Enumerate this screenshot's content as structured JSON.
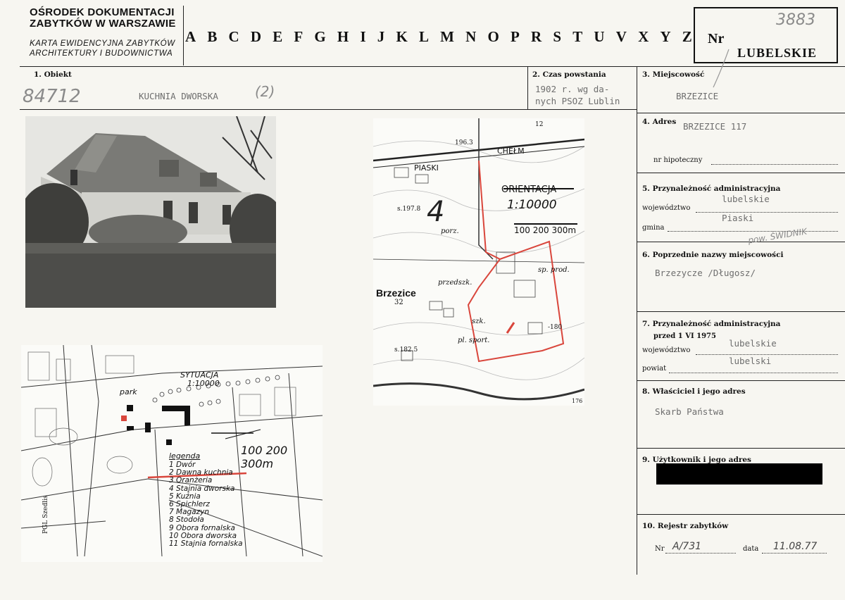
{
  "header": {
    "org_line1": "OŚRODEK DOKUMENTACJI",
    "org_line2": "ZABYTKÓW W WARSZAWIE",
    "subtitle_line1": "KARTA EWIDENCYJNA ZABYTKÓW",
    "subtitle_line2": "ARCHITEKTURY I BUDOWNICTWA",
    "letters": [
      "A",
      "B",
      "C",
      "D",
      "E",
      "F",
      "G",
      "H",
      "I",
      "J",
      "K",
      "L",
      "M",
      "N",
      "O",
      "P",
      "R",
      "S",
      "T",
      "U",
      "V",
      "X",
      "Y",
      "Z"
    ],
    "nr_label": "Nr",
    "nr_value": "3883",
    "region": "LUBELSKIE"
  },
  "fields": {
    "obiekt_label": "1. Obiekt",
    "obiekt_hand": "84712",
    "obiekt_value": "KUCHNIA DWORSKA",
    "obiekt_note": "(2)",
    "czas_label": "2. Czas powstania",
    "czas_line1": "1902 r. wg da-",
    "czas_line2": "nych PSOZ Lublin",
    "miejsc_label": "3. Miejscowość",
    "miejsc_value": "BRZEZICE",
    "adres_label": "4. Adres",
    "adres_value": "BRZEZICE 117",
    "hipoteczny_label": "nr hipoteczny",
    "przyn_label": "5. Przynależność administracyjna",
    "woj_label": "województwo",
    "woj_value": "lubelskie",
    "gmina_label": "gmina",
    "gmina_value": "Piaski",
    "pow_hand": "pow. ŚWIDNIK",
    "poprz_label": "6. Poprzednie nazwy miejscowości",
    "poprz_value": "Brzezycze /Długosz/",
    "przyn75_label": "7. Przynależność administracyjna",
    "przed_label": "przed 1 VI 1975",
    "woj75_label": "województwo",
    "woj75_value": "lubelskie",
    "powiat_label": "powiat",
    "powiat_value": "lubelski",
    "wlasc_label": "8. Właściciel i jego adres",
    "wlasc_value": "Skarb Państwa",
    "uzytk_label": "9. Użytkownik i jego adres",
    "rejestr_label": "10. Rejestr zabytków",
    "rej_nr_label": "Nr",
    "rej_nr_value": "A/731",
    "rej_data_label": "data",
    "rej_data_value": "11.08.77"
  },
  "topo_map": {
    "orientacja": "ORIENTACJA",
    "scale": "1:10000",
    "scale_ticks": "100 200 300m",
    "labels": [
      "PIASKI",
      "CHEŁM",
      "Brzezice",
      "32",
      "porz.",
      "przedszk.",
      "sp. prod.",
      "szk.",
      "pl. sport.",
      "s.197.8",
      "s.182.5",
      "196.3",
      "12",
      "4",
      "-180",
      "176"
    ]
  },
  "site_plan": {
    "sytuacja": "SYTUACJA",
    "scale": "1:10000",
    "scale_ticks": "100  200 300m",
    "park": "park",
    "pgl": "PGL Szedlis",
    "legend_title": "legenda",
    "legend": [
      "1 Dwór",
      "2 Dawna kuchnia",
      "3 Oranżeria",
      "4 Stajnia dworska",
      "5 Kuźnia",
      "6 Spichlerz",
      "7 Magazyn",
      "8 Stodoła",
      "9 Obora fornalska",
      "10 Obora dworska",
      "11 Stajnia fornalska"
    ]
  },
  "colors": {
    "red_marking": "#d9463c",
    "ink": "#111111",
    "typed": "#6e6e6e"
  }
}
